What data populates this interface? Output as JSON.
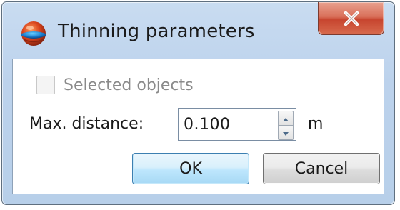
{
  "window": {
    "title": "Thinning parameters",
    "app_icon": "globe-icon",
    "close_icon": "close-icon",
    "close_label": "X"
  },
  "form": {
    "selected_objects": {
      "label": "Selected objects",
      "checked": false,
      "enabled": false
    },
    "max_distance": {
      "label": "Max. distance:",
      "value": "0.100",
      "unit": "m",
      "spin_up_icon": "spin-up-arrow-icon",
      "spin_down_icon": "spin-down-arrow-icon"
    }
  },
  "buttons": {
    "ok_label": "OK",
    "cancel_label": "Cancel"
  },
  "colors": {
    "frame": "#bcd2ec",
    "close_button": "#c7452f",
    "default_button_border": "#3c7fb1",
    "disabled_text": "#8a8a8a"
  }
}
